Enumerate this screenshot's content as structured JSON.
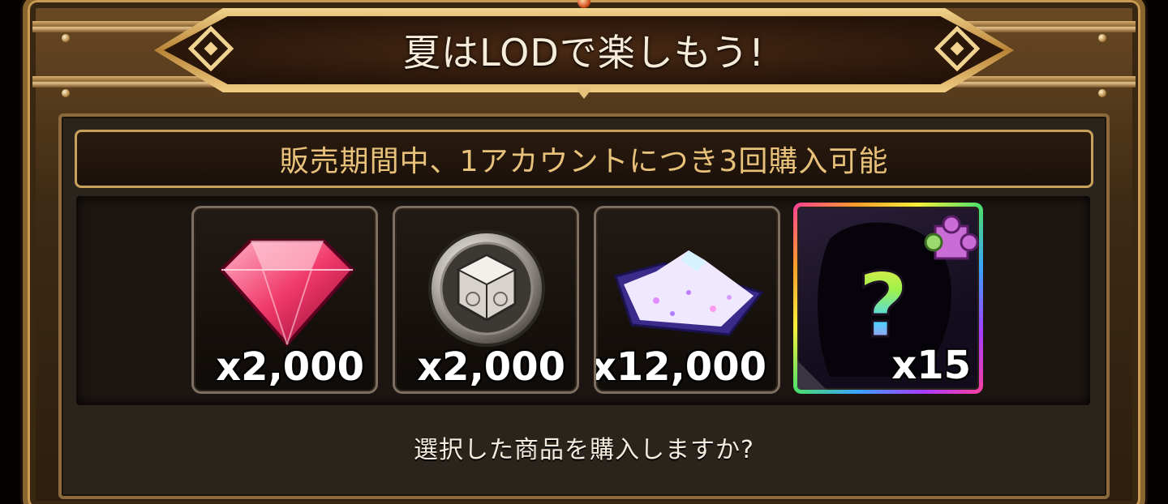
{
  "dialog": {
    "title": "夏はLODで楽しもう!",
    "notice": "販売期間中、1アカウントにつき3回購入可能",
    "question": "選択した商品を購入しますか?"
  },
  "items": [
    {
      "name": "ruby-gem",
      "icon": "ruby-gem-icon",
      "quantity": "x2,000"
    },
    {
      "name": "silver-dice-coin",
      "icon": "dice-coin-icon",
      "quantity": "x2,000"
    },
    {
      "name": "crystal-powder",
      "icon": "crystal-powder-icon",
      "quantity": "x12,000"
    },
    {
      "name": "mystery-puzzle-piece",
      "icon": "mystery-puzzle-icon",
      "quantity": "x15"
    }
  ],
  "colors": {
    "frame_gold": "#c99a52",
    "notice_text": "#e8c27a",
    "panel_bg": "#2b241d"
  }
}
